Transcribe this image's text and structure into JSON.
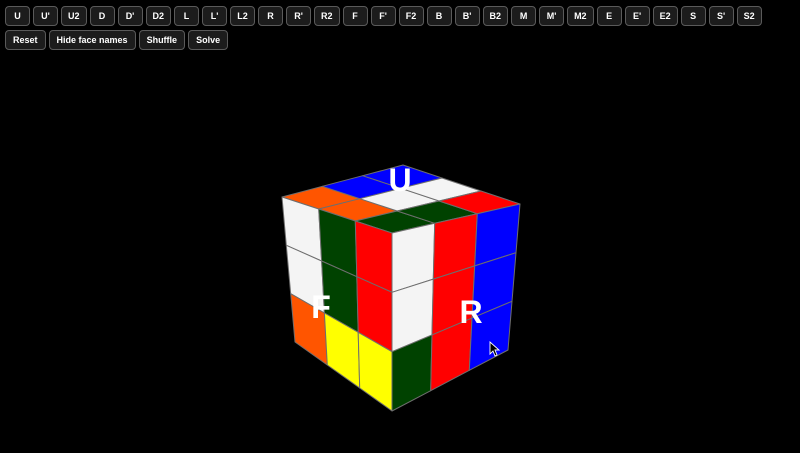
{
  "moves": [
    "U",
    "U'",
    "U2",
    "D",
    "D'",
    "D2",
    "L",
    "L'",
    "L2",
    "R",
    "R'",
    "R2",
    "F",
    "F'",
    "F2",
    "B",
    "B'",
    "B2",
    "M",
    "M'",
    "M2",
    "E",
    "E'",
    "E2",
    "S",
    "S'",
    "S2"
  ],
  "controls": {
    "reset": "Reset",
    "hide_face_names": "Hide face names",
    "shuffle": "Shuffle",
    "solve": "Solve"
  },
  "face_labels": {
    "up": "U",
    "front": "F",
    "right": "R"
  },
  "cube": {
    "up": [
      [
        "orange",
        "blue",
        "blue"
      ],
      [
        "orange",
        "white",
        "white"
      ],
      [
        "green",
        "green",
        "red"
      ]
    ],
    "front": [
      [
        "white",
        "green",
        "red"
      ],
      [
        "white",
        "green",
        "red"
      ],
      [
        "orange",
        "yellow",
        "yellow"
      ]
    ],
    "right": [
      [
        "white",
        "red",
        "blue"
      ],
      [
        "white",
        "red",
        "blue"
      ],
      [
        "green",
        "red",
        "blue"
      ]
    ]
  },
  "colors": {
    "white": "#f4f4f4",
    "red": "#ff0000",
    "blue": "#0000ff",
    "green": "#004200",
    "orange": "#ff5500",
    "yellow": "#ffff00",
    "background": "#000000"
  }
}
